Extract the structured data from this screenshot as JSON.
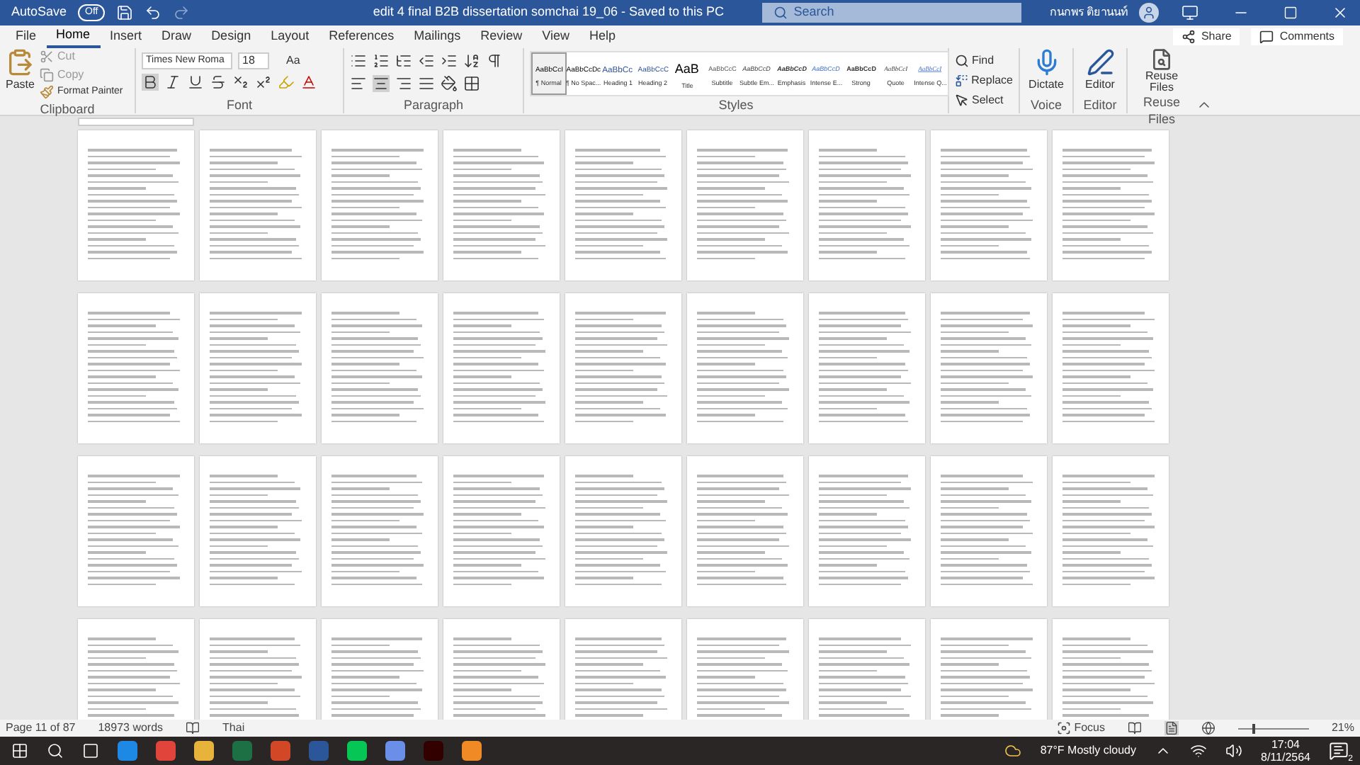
{
  "title_bar": {
    "autosave_label": "AutoSave",
    "autosave_toggle": "Off",
    "autosave_on": false,
    "title": "edit 4 final B2B dissertation somchai 19_06  -  Saved to this PC",
    "search_placeholder": "Search",
    "user_name": "กนกพร ติยานนท์"
  },
  "menu_tabs": [
    {
      "label": "File",
      "selected": false
    },
    {
      "label": "Home",
      "selected": true
    },
    {
      "label": "Insert",
      "selected": false
    },
    {
      "label": "Draw",
      "selected": false
    },
    {
      "label": "Design",
      "selected": false
    },
    {
      "label": "Layout",
      "selected": false
    },
    {
      "label": "References",
      "selected": false
    },
    {
      "label": "Mailings",
      "selected": false
    },
    {
      "label": "Review",
      "selected": false
    },
    {
      "label": "View",
      "selected": false
    },
    {
      "label": "Help",
      "selected": false
    }
  ],
  "share_label": "Share",
  "comments_label": "Comments",
  "clipboard": {
    "paste": "Paste",
    "cut": "Cut",
    "copy": "Copy",
    "format_painter": "Format Painter",
    "group": "Clipboard"
  },
  "font": {
    "name": "Times New Roma",
    "size": "18",
    "case": "Aa",
    "group": "Font"
  },
  "paragraph": {
    "group": "Paragraph"
  },
  "styles": {
    "group": "Styles",
    "items": [
      {
        "preview": "AaBbCcI",
        "name": "¶ Normal",
        "selected": true,
        "kind": "normal"
      },
      {
        "preview": "AaBbCcDc",
        "name": "¶ No Spac...",
        "selected": false,
        "kind": "normal"
      },
      {
        "preview": "AaBbCc",
        "name": "Heading 1",
        "selected": false,
        "kind": "heading1"
      },
      {
        "preview": "AaBbCcC",
        "name": "Heading 2",
        "selected": false,
        "kind": "heading2"
      },
      {
        "preview": "AaB",
        "name": "Title",
        "selected": false,
        "kind": "title"
      },
      {
        "preview": "AaBbCcC",
        "name": "Subtitle",
        "selected": false,
        "kind": "subtitle"
      },
      {
        "preview": "AaBbCcD",
        "name": "Subtle Em...",
        "selected": false,
        "kind": "italic"
      },
      {
        "preview": "AaBbCcD",
        "name": "Emphasis",
        "selected": false,
        "kind": "bolditalic"
      },
      {
        "preview": "AaBbCcD",
        "name": "Intense E...",
        "selected": false,
        "kind": "intense"
      },
      {
        "preview": "AaBbCcD",
        "name": "Strong",
        "selected": false,
        "kind": "strong"
      },
      {
        "preview": "AaBbCcI",
        "name": "Quote",
        "selected": false,
        "kind": "quote"
      },
      {
        "preview": "AaBbCcI",
        "name": "Intense Q...",
        "selected": false,
        "kind": "intensequote"
      }
    ]
  },
  "editing": {
    "find": "Find",
    "replace": "Replace",
    "select": "Select"
  },
  "voice": {
    "button": "Dictate",
    "group": "Voice"
  },
  "editor": {
    "button": "Editor",
    "group": "Editor"
  },
  "reuse": {
    "button": "Reuse Files",
    "group": "Reuse Files"
  },
  "status_bar": {
    "page": "Page 11 of 87",
    "words": "18973 words",
    "language": "Thai",
    "focus": "Focus",
    "zoom": "21%",
    "level": 0.2
  },
  "taskbar": {
    "weather": "87°F  Mostly cloudy",
    "time": "17:04",
    "date": "8/11/2564",
    "notifications": "2"
  }
}
